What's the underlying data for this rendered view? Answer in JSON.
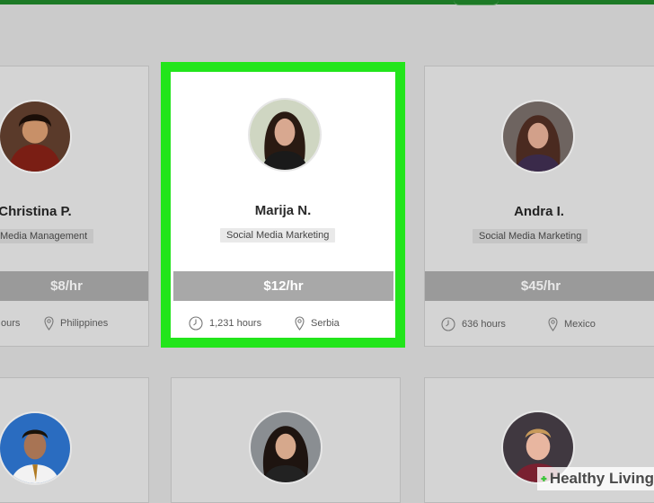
{
  "brand": {
    "watermark": "Healthy Living",
    "cross_color": "#3ec43a"
  },
  "colors": {
    "highlight": "#22e51b",
    "top_bar": "#1d7a26"
  },
  "freelancers": [
    {
      "name": "Christina P.",
      "skill": "Media Management",
      "rate": "$8/hr",
      "hours": "ours",
      "location": "Philippines"
    },
    {
      "name": "Marija N.",
      "skill": "Social Media Marketing",
      "rate": "$12/hr",
      "hours": "1,231 hours",
      "location": "Serbia",
      "selected": true
    },
    {
      "name": "Andra I.",
      "skill": "Social Media Marketing",
      "rate": "$45/hr",
      "hours": "636 hours",
      "location": "Mexico"
    }
  ],
  "icons": {
    "hours": "clock-icon",
    "location": "map-pin-icon"
  }
}
